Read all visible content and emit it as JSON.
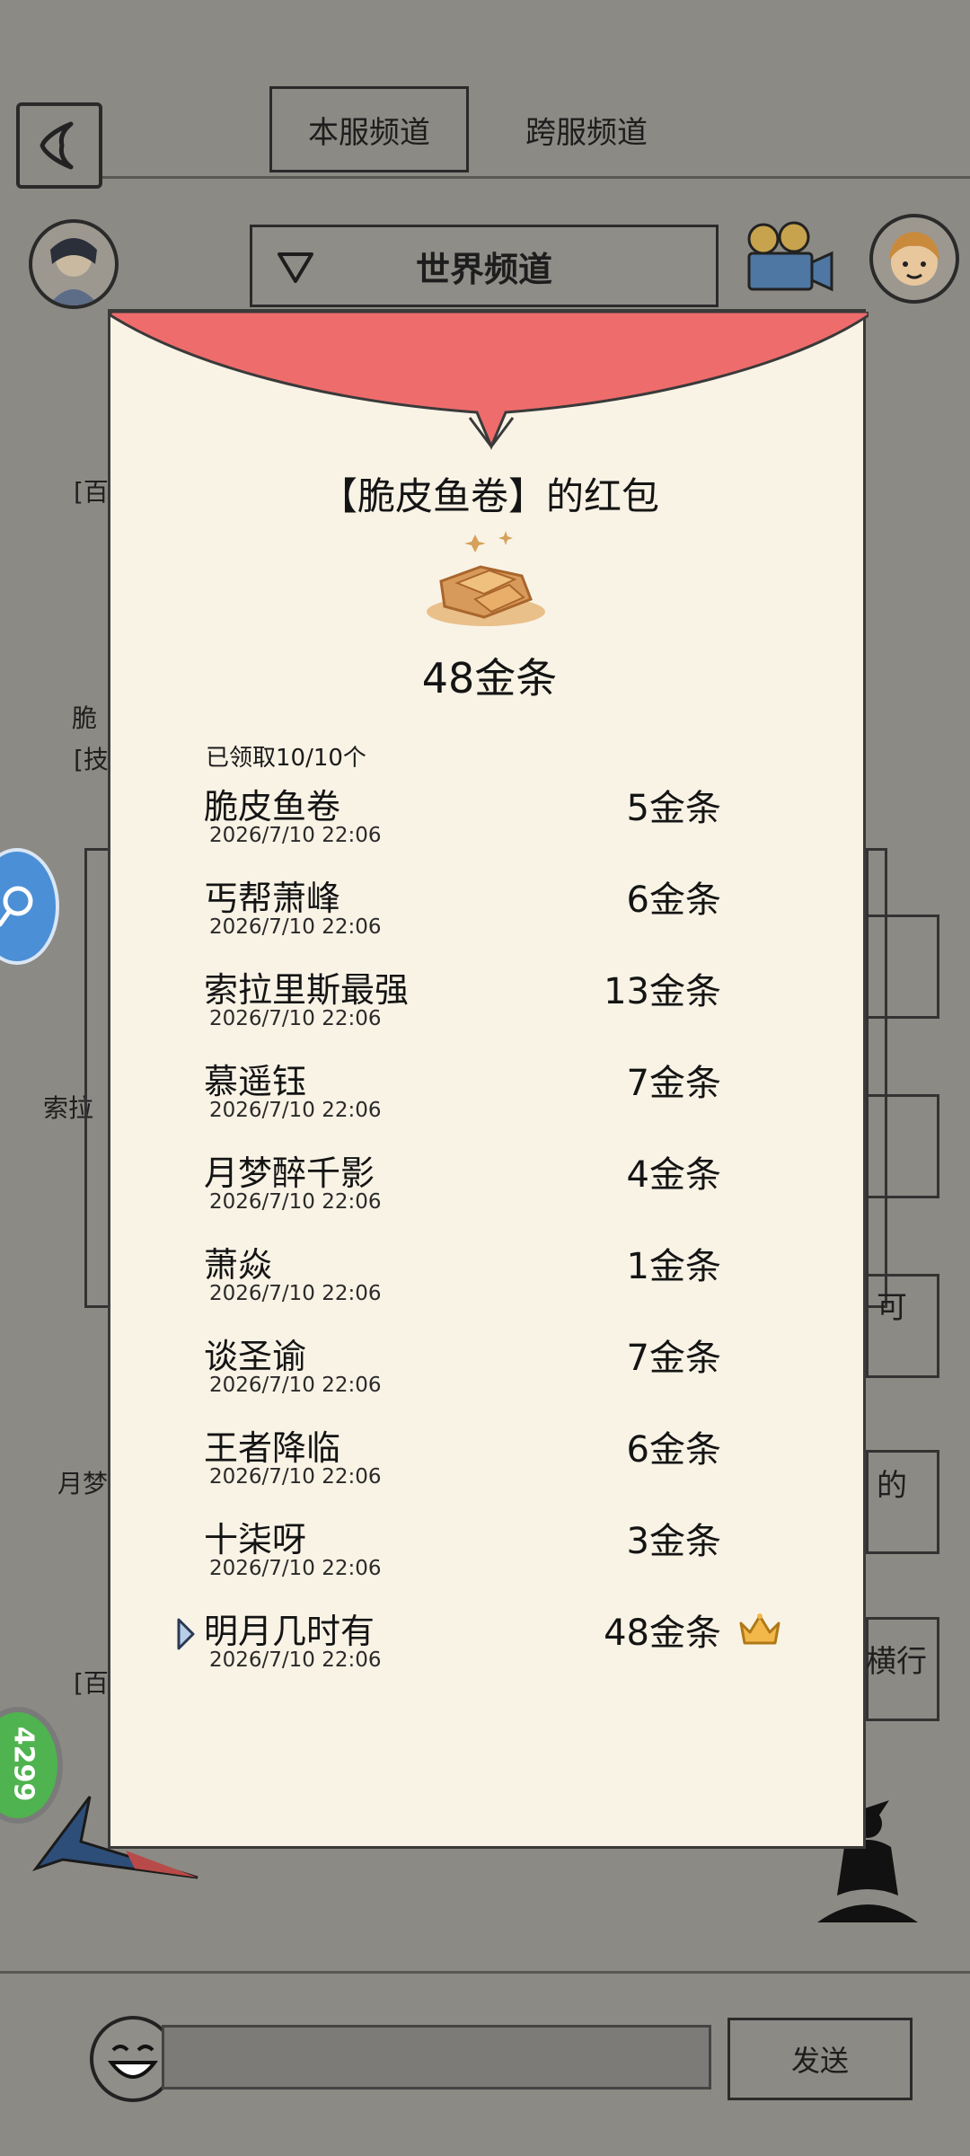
{
  "background": {
    "tabs": [
      "本服频道",
      "跨服频道"
    ],
    "channel": "世界频道",
    "send_label": "发送",
    "edge_fragments": [
      "[百",
      "脆",
      "[技",
      "索拉",
      "月梦",
      "[百"
    ],
    "side_fragments": [
      "可",
      "的",
      "横行"
    ],
    "float_badge": "4299"
  },
  "red_packet": {
    "title": "【脆皮鱼卷】的红包",
    "total": "48金条",
    "claimed": "已领取10/10个",
    "entries": [
      {
        "name": "脆皮鱼卷",
        "time": "2026/7/10 22:06",
        "amount": "5金条"
      },
      {
        "name": "丐帮萧峰",
        "time": "2026/7/10 22:06",
        "amount": "6金条"
      },
      {
        "name": "索拉里斯最强",
        "time": "2026/7/10 22:06",
        "amount": "13金条"
      },
      {
        "name": "慕遥钰",
        "time": "2026/7/10 22:06",
        "amount": "7金条"
      },
      {
        "name": "月梦醉千影",
        "time": "2026/7/10 22:06",
        "amount": "4金条"
      },
      {
        "name": "萧焱",
        "time": "2026/7/10 22:06",
        "amount": "1金条"
      },
      {
        "name": "谈圣谕",
        "time": "2026/7/10 22:06",
        "amount": "7金条"
      },
      {
        "name": "王者降临",
        "time": "2026/7/10 22:06",
        "amount": "6金条"
      },
      {
        "name": "十柒呀",
        "time": "2026/7/10 22:06",
        "amount": "3金条"
      },
      {
        "name": "明月几时有",
        "time": "2026/7/10 22:06",
        "amount": "48金条"
      }
    ]
  },
  "colors": {
    "flap_red": "#f26b6b",
    "modal_bg": "#f9f3e6",
    "overlay": "#8a8882"
  }
}
